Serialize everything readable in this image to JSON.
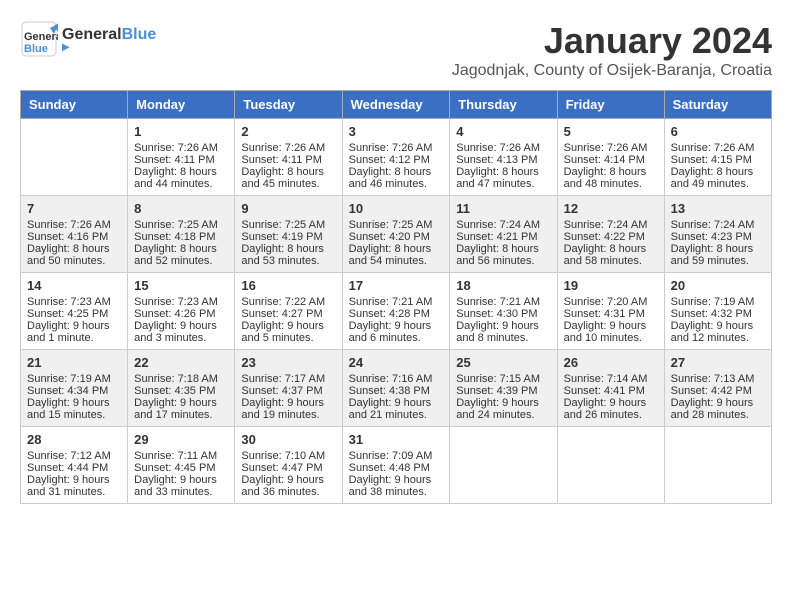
{
  "header": {
    "logo_general": "General",
    "logo_blue": "Blue",
    "month_title": "January 2024",
    "subtitle": "Jagodnjak, County of Osijek-Baranja, Croatia"
  },
  "days_of_week": [
    "Sunday",
    "Monday",
    "Tuesday",
    "Wednesday",
    "Thursday",
    "Friday",
    "Saturday"
  ],
  "weeks": [
    [
      {
        "day": "",
        "sunrise": "",
        "sunset": "",
        "daylight": ""
      },
      {
        "day": "1",
        "sunrise": "Sunrise: 7:26 AM",
        "sunset": "Sunset: 4:11 PM",
        "daylight": "Daylight: 8 hours and 44 minutes."
      },
      {
        "day": "2",
        "sunrise": "Sunrise: 7:26 AM",
        "sunset": "Sunset: 4:11 PM",
        "daylight": "Daylight: 8 hours and 45 minutes."
      },
      {
        "day": "3",
        "sunrise": "Sunrise: 7:26 AM",
        "sunset": "Sunset: 4:12 PM",
        "daylight": "Daylight: 8 hours and 46 minutes."
      },
      {
        "day": "4",
        "sunrise": "Sunrise: 7:26 AM",
        "sunset": "Sunset: 4:13 PM",
        "daylight": "Daylight: 8 hours and 47 minutes."
      },
      {
        "day": "5",
        "sunrise": "Sunrise: 7:26 AM",
        "sunset": "Sunset: 4:14 PM",
        "daylight": "Daylight: 8 hours and 48 minutes."
      },
      {
        "day": "6",
        "sunrise": "Sunrise: 7:26 AM",
        "sunset": "Sunset: 4:15 PM",
        "daylight": "Daylight: 8 hours and 49 minutes."
      }
    ],
    [
      {
        "day": "7",
        "sunrise": "Sunrise: 7:26 AM",
        "sunset": "Sunset: 4:16 PM",
        "daylight": "Daylight: 8 hours and 50 minutes."
      },
      {
        "day": "8",
        "sunrise": "Sunrise: 7:25 AM",
        "sunset": "Sunset: 4:18 PM",
        "daylight": "Daylight: 8 hours and 52 minutes."
      },
      {
        "day": "9",
        "sunrise": "Sunrise: 7:25 AM",
        "sunset": "Sunset: 4:19 PM",
        "daylight": "Daylight: 8 hours and 53 minutes."
      },
      {
        "day": "10",
        "sunrise": "Sunrise: 7:25 AM",
        "sunset": "Sunset: 4:20 PM",
        "daylight": "Daylight: 8 hours and 54 minutes."
      },
      {
        "day": "11",
        "sunrise": "Sunrise: 7:24 AM",
        "sunset": "Sunset: 4:21 PM",
        "daylight": "Daylight: 8 hours and 56 minutes."
      },
      {
        "day": "12",
        "sunrise": "Sunrise: 7:24 AM",
        "sunset": "Sunset: 4:22 PM",
        "daylight": "Daylight: 8 hours and 58 minutes."
      },
      {
        "day": "13",
        "sunrise": "Sunrise: 7:24 AM",
        "sunset": "Sunset: 4:23 PM",
        "daylight": "Daylight: 8 hours and 59 minutes."
      }
    ],
    [
      {
        "day": "14",
        "sunrise": "Sunrise: 7:23 AM",
        "sunset": "Sunset: 4:25 PM",
        "daylight": "Daylight: 9 hours and 1 minute."
      },
      {
        "day": "15",
        "sunrise": "Sunrise: 7:23 AM",
        "sunset": "Sunset: 4:26 PM",
        "daylight": "Daylight: 9 hours and 3 minutes."
      },
      {
        "day": "16",
        "sunrise": "Sunrise: 7:22 AM",
        "sunset": "Sunset: 4:27 PM",
        "daylight": "Daylight: 9 hours and 5 minutes."
      },
      {
        "day": "17",
        "sunrise": "Sunrise: 7:21 AM",
        "sunset": "Sunset: 4:28 PM",
        "daylight": "Daylight: 9 hours and 6 minutes."
      },
      {
        "day": "18",
        "sunrise": "Sunrise: 7:21 AM",
        "sunset": "Sunset: 4:30 PM",
        "daylight": "Daylight: 9 hours and 8 minutes."
      },
      {
        "day": "19",
        "sunrise": "Sunrise: 7:20 AM",
        "sunset": "Sunset: 4:31 PM",
        "daylight": "Daylight: 9 hours and 10 minutes."
      },
      {
        "day": "20",
        "sunrise": "Sunrise: 7:19 AM",
        "sunset": "Sunset: 4:32 PM",
        "daylight": "Daylight: 9 hours and 12 minutes."
      }
    ],
    [
      {
        "day": "21",
        "sunrise": "Sunrise: 7:19 AM",
        "sunset": "Sunset: 4:34 PM",
        "daylight": "Daylight: 9 hours and 15 minutes."
      },
      {
        "day": "22",
        "sunrise": "Sunrise: 7:18 AM",
        "sunset": "Sunset: 4:35 PM",
        "daylight": "Daylight: 9 hours and 17 minutes."
      },
      {
        "day": "23",
        "sunrise": "Sunrise: 7:17 AM",
        "sunset": "Sunset: 4:37 PM",
        "daylight": "Daylight: 9 hours and 19 minutes."
      },
      {
        "day": "24",
        "sunrise": "Sunrise: 7:16 AM",
        "sunset": "Sunset: 4:38 PM",
        "daylight": "Daylight: 9 hours and 21 minutes."
      },
      {
        "day": "25",
        "sunrise": "Sunrise: 7:15 AM",
        "sunset": "Sunset: 4:39 PM",
        "daylight": "Daylight: 9 hours and 24 minutes."
      },
      {
        "day": "26",
        "sunrise": "Sunrise: 7:14 AM",
        "sunset": "Sunset: 4:41 PM",
        "daylight": "Daylight: 9 hours and 26 minutes."
      },
      {
        "day": "27",
        "sunrise": "Sunrise: 7:13 AM",
        "sunset": "Sunset: 4:42 PM",
        "daylight": "Daylight: 9 hours and 28 minutes."
      }
    ],
    [
      {
        "day": "28",
        "sunrise": "Sunrise: 7:12 AM",
        "sunset": "Sunset: 4:44 PM",
        "daylight": "Daylight: 9 hours and 31 minutes."
      },
      {
        "day": "29",
        "sunrise": "Sunrise: 7:11 AM",
        "sunset": "Sunset: 4:45 PM",
        "daylight": "Daylight: 9 hours and 33 minutes."
      },
      {
        "day": "30",
        "sunrise": "Sunrise: 7:10 AM",
        "sunset": "Sunset: 4:47 PM",
        "daylight": "Daylight: 9 hours and 36 minutes."
      },
      {
        "day": "31",
        "sunrise": "Sunrise: 7:09 AM",
        "sunset": "Sunset: 4:48 PM",
        "daylight": "Daylight: 9 hours and 38 minutes."
      },
      {
        "day": "",
        "sunrise": "",
        "sunset": "",
        "daylight": ""
      },
      {
        "day": "",
        "sunrise": "",
        "sunset": "",
        "daylight": ""
      },
      {
        "day": "",
        "sunrise": "",
        "sunset": "",
        "daylight": ""
      }
    ]
  ]
}
